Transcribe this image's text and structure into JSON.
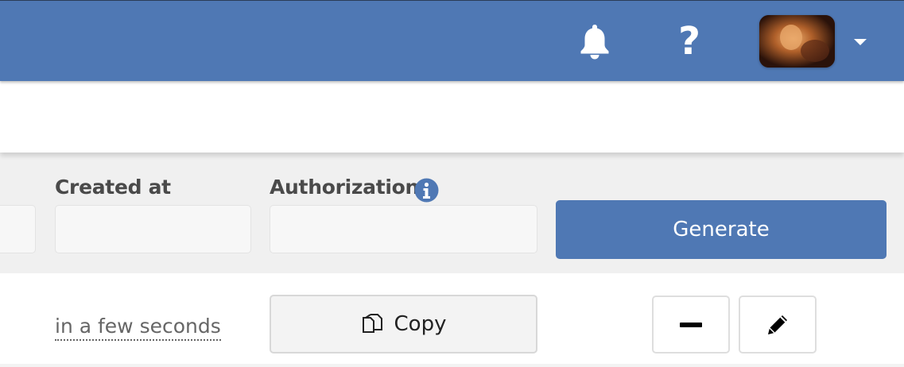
{
  "header": {
    "icons": [
      "bell-icon",
      "question-icon",
      "avatar",
      "caret-down-icon"
    ],
    "accent": "#4f78b4"
  },
  "form": {
    "created_at_label": "Created at",
    "authorization_label": "Authorization",
    "created_at_value": "",
    "authorization_value": "",
    "generate_label": "Generate"
  },
  "row": {
    "time_text": "in a few seconds",
    "copy_label": "Copy"
  }
}
